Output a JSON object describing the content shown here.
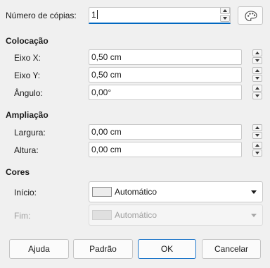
{
  "copies": {
    "label": "Número de cópias:",
    "value": "1"
  },
  "placement": {
    "section_label": "Colocação",
    "x_label": "Eixo X:",
    "x_value": "0,50 cm",
    "y_label": "Eixo Y:",
    "y_value": "0,50 cm",
    "angle_label": "Ângulo:",
    "angle_value": "0,00°"
  },
  "enlargement": {
    "section_label": "Ampliação",
    "width_label": "Largura:",
    "width_value": "0,00 cm",
    "height_label": "Altura:",
    "height_value": "0,00 cm"
  },
  "colors": {
    "section_label": "Cores",
    "start_label": "Início:",
    "start_value": "Automático",
    "start_swatch": "#ececec",
    "end_label": "Fim:",
    "end_value": "Automático",
    "end_swatch": "#e0e0e0"
  },
  "buttons": {
    "help": "Ajuda",
    "reset": "Padrão",
    "ok": "OK",
    "cancel": "Cancelar"
  },
  "accent_color": "#0067c0",
  "icons": {
    "palette": "palette-icon"
  }
}
